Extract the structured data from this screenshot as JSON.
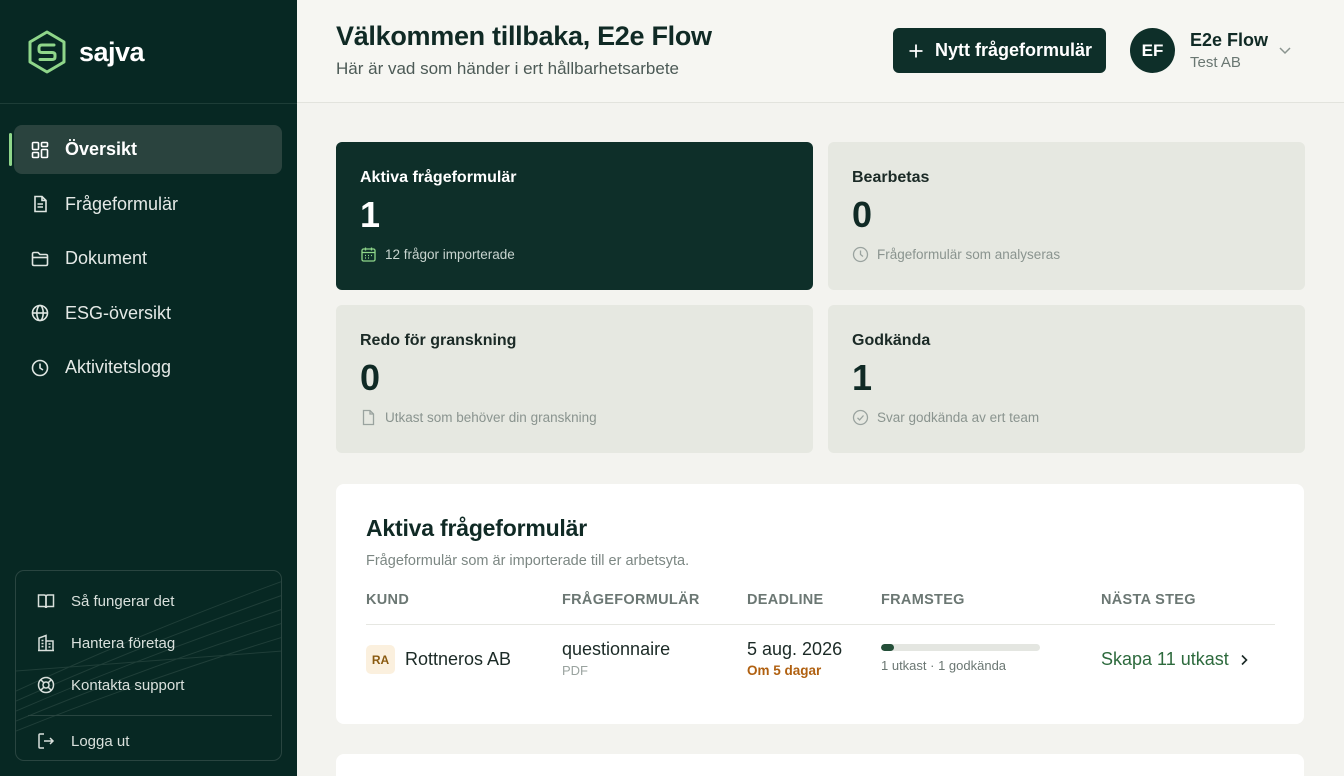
{
  "brand": {
    "name": "sajva"
  },
  "sidebar": {
    "items": [
      {
        "label": "Översikt",
        "icon": "grid-icon",
        "active": true
      },
      {
        "label": "Frågeformulär",
        "icon": "document-icon"
      },
      {
        "label": "Dokument",
        "icon": "folder-icon"
      },
      {
        "label": "ESG-översikt",
        "icon": "globe-icon"
      },
      {
        "label": "Aktivitetslogg",
        "icon": "clock-icon"
      }
    ],
    "help": {
      "how": "Så fungerar det",
      "companies": "Hantera företag",
      "support": "Kontakta support",
      "logout": "Logga ut"
    }
  },
  "header": {
    "title": "Välkommen tillbaka, E2e Flow",
    "subtitle": "Här är vad som händer i ert hållbarhetsarbete",
    "new_button": "Nytt frågeformulär",
    "user": {
      "initials": "EF",
      "name": "E2e Flow",
      "org": "Test AB"
    }
  },
  "stats": [
    {
      "title": "Aktiva frågeformulär",
      "value": "1",
      "note": "12 frågor importerade",
      "icon": "calendar-icon"
    },
    {
      "title": "Bearbetas",
      "value": "0",
      "note": "Frågeformulär som analyseras",
      "icon": "clock-icon"
    },
    {
      "title": "Redo för granskning",
      "value": "0",
      "note": "Utkast som behöver din granskning",
      "icon": "document-icon"
    },
    {
      "title": "Godkända",
      "value": "1",
      "note": "Svar godkända av ert team",
      "icon": "check-circle-icon"
    }
  ],
  "active_table": {
    "title": "Aktiva frågeformulär",
    "subtitle": "Frågeformulär som är importerade till er arbetsyta.",
    "columns": [
      "KUND",
      "FRÅGEFORMULÄR",
      "DEADLINE",
      "FRAMSTEG",
      "NÄSTA STEG"
    ],
    "rows": [
      {
        "client_initials": "RA",
        "client": "Rottneros AB",
        "questionnaire": "questionnaire",
        "file_type": "PDF",
        "deadline": "5 aug. 2026",
        "deadline_relative": "Om 5 dagar",
        "progress": 0.08,
        "progress_label": "1 utkast · 1 godkända",
        "next_step": "Skapa 11 utkast"
      }
    ]
  },
  "colors": {
    "sidebar_bg": "#072823",
    "primary": "#0e2f29",
    "accent": "#8fd68a",
    "deadline_warning": "#b06010",
    "link": "#2d6a3d"
  }
}
